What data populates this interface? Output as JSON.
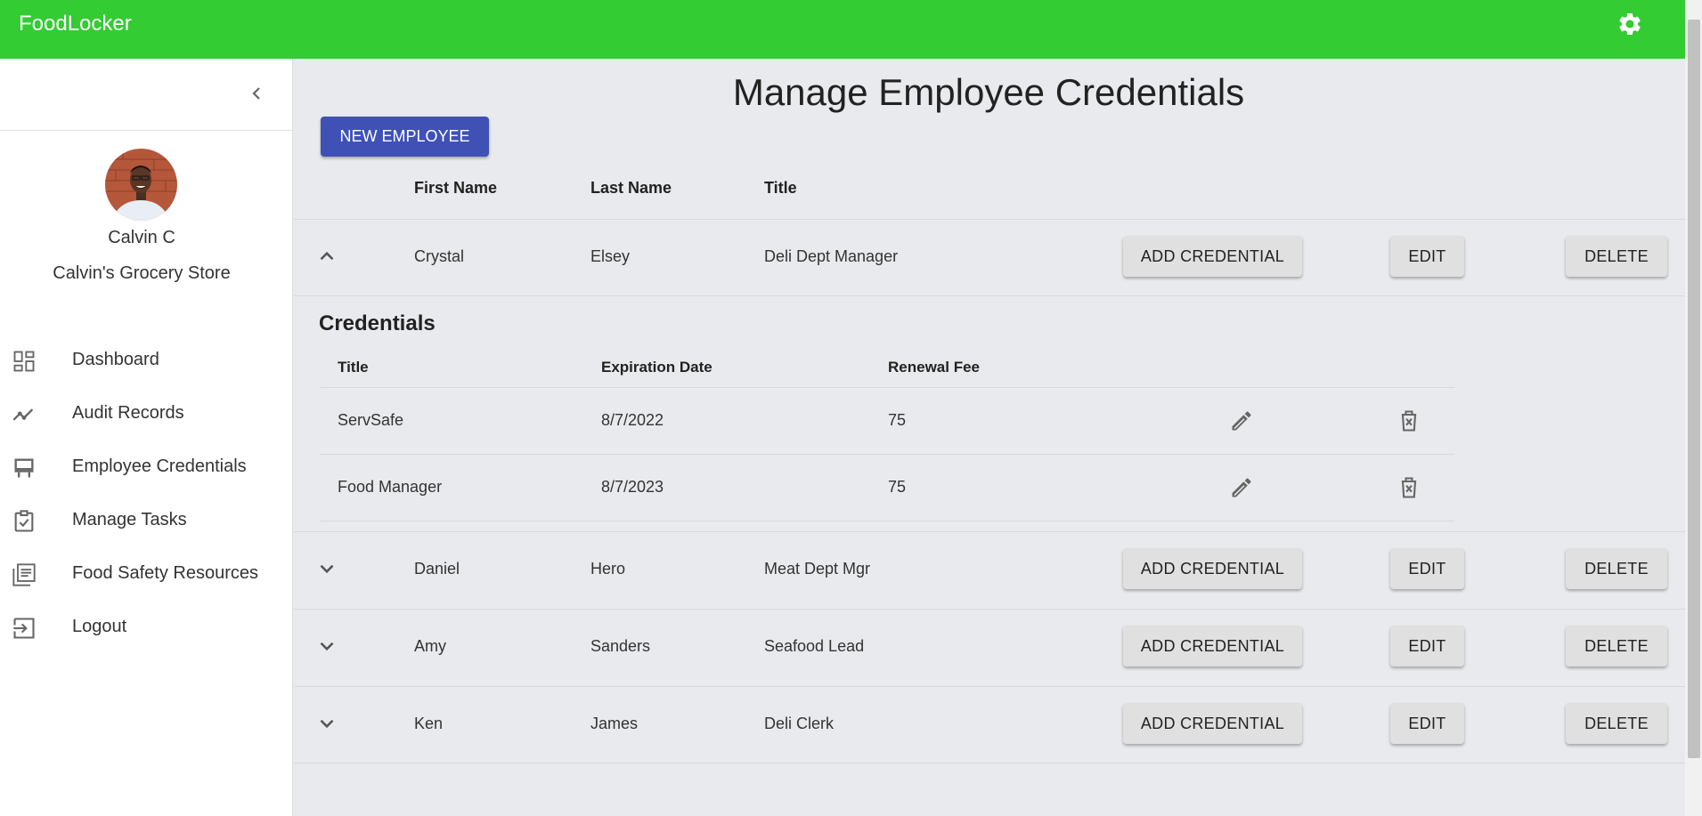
{
  "app": {
    "brand": "FoodLocker"
  },
  "sidebar": {
    "user_name": "Calvin C",
    "store_name": "Calvin's Grocery Store",
    "items": [
      {
        "label": "Dashboard",
        "icon": "dashboard-icon"
      },
      {
        "label": "Audit Records",
        "icon": "trending-icon"
      },
      {
        "label": "Employee Credentials",
        "icon": "badge-icon"
      },
      {
        "label": "Manage Tasks",
        "icon": "task-icon"
      },
      {
        "label": "Food Safety Resources",
        "icon": "library-icon"
      },
      {
        "label": "Logout",
        "icon": "logout-icon"
      }
    ]
  },
  "main": {
    "title": "Manage Employee Credentials",
    "new_button": "NEW EMPLOYEE",
    "headers": {
      "first": "First Name",
      "last": "Last Name",
      "title": "Title"
    },
    "buttons": {
      "add": "ADD CREDENTIAL",
      "edit": "EDIT",
      "delete": "DELETE"
    },
    "employees": [
      {
        "first": "Crystal",
        "last": "Elsey",
        "title": "Deli Dept Manager",
        "expanded": true
      },
      {
        "first": "Daniel",
        "last": "Hero",
        "title": "Meat Dept Mgr",
        "expanded": false
      },
      {
        "first": "Amy",
        "last": "Sanders",
        "title": "Seafood Lead",
        "expanded": false
      },
      {
        "first": "Ken",
        "last": "James",
        "title": "Deli Clerk",
        "expanded": false
      }
    ],
    "credentials": {
      "heading": "Credentials",
      "headers": {
        "title": "Title",
        "expiration": "Expiration Date",
        "fee": "Renewal Fee"
      },
      "rows": [
        {
          "title": "ServSafe",
          "expiration": "8/7/2022",
          "fee": "75"
        },
        {
          "title": "Food Manager",
          "expiration": "8/7/2023",
          "fee": "75"
        }
      ]
    }
  },
  "colors": {
    "appbar": "#33cc33",
    "primary": "#3f51b5",
    "background": "#e9eaed"
  }
}
